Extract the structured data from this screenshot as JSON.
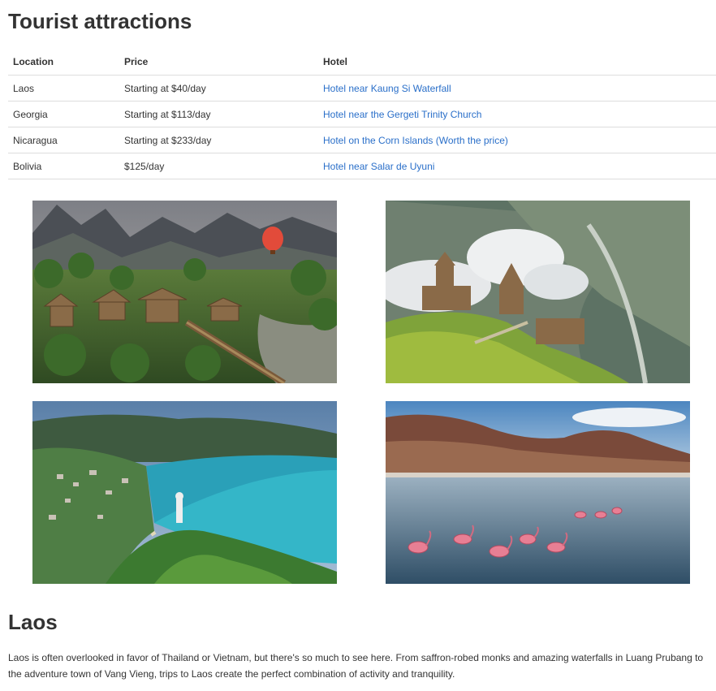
{
  "title": "Tourist attractions",
  "table": {
    "headers": [
      "Location",
      "Price",
      "Hotel"
    ],
    "rows": [
      {
        "location": "Laos",
        "price": "Starting at $40/day",
        "hotel": "Hotel near Kaung Si Waterfall"
      },
      {
        "location": "Georgia",
        "price": "Starting at $113/day",
        "hotel": "Hotel near the Gergeti Trinity Church"
      },
      {
        "location": "Nicaragua",
        "price": "Starting at $233/day",
        "hotel": "Hotel on the Corn Islands (Worth the price)"
      },
      {
        "location": "Bolivia",
        "price": "$125/day",
        "hotel": "Hotel near Salar de Uyuni"
      }
    ]
  },
  "colors": {
    "link": "#2a6fc9",
    "text": "#333333",
    "rule": "#dddddd"
  },
  "section": {
    "heading": "Laos",
    "body": "Laos is often overlooked in favor of Thailand or Vietnam, but there's so much to see here. From saffron-robed monks and amazing waterfalls in Luang Prubang to the adventure town of Vang Vieng, trips to Laos create the perfect combination of activity and tranquility."
  }
}
